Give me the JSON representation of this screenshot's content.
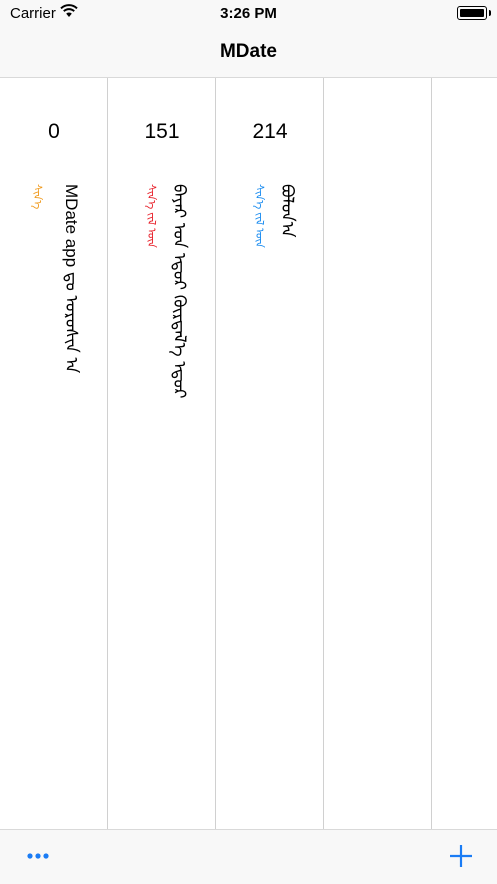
{
  "status": {
    "carrier": "Carrier",
    "time": "3:26 PM"
  },
  "nav": {
    "title": "MDate"
  },
  "columns": [
    {
      "count": "0",
      "label": "ᠰᠢᠨ᠎ᠡ",
      "label_color": "#f09a1e",
      "text": "MDate app ᠳᠤ ᠣᠷᠣᠰᠢᠨ ᠠ"
    },
    {
      "count": "151",
      "label": "ᠰᠢᠨ᠎ᠡ ᠵᠢᠯ ᠦᠨ",
      "label_color": "#e8202a",
      "text": "ᠪᠠᠶᠠᠷ ᠤᠨ ᠡᠳᠦᠷ ᠬᠦᠷᠲᠡᠯ᠎ᠡ ᠡᠳᠦᠷ"
    },
    {
      "count": "214",
      "label": "ᠰᠢᠨ᠎ᠡ ᠵᠢᠯ ᠦᠨ",
      "label_color": "#1a8cf0",
      "text": "ᠪᠤᠯᠤᠨ᠎ᠠ"
    },
    {
      "count": "",
      "label": "",
      "label_color": "#000000",
      "text": ""
    },
    {
      "count": "",
      "label": "",
      "label_color": "#000000",
      "text": ""
    }
  ],
  "toolbar": {
    "more_icon": "ellipsis-icon",
    "add_icon": "plus-icon",
    "accent": "#1a7cf5"
  }
}
